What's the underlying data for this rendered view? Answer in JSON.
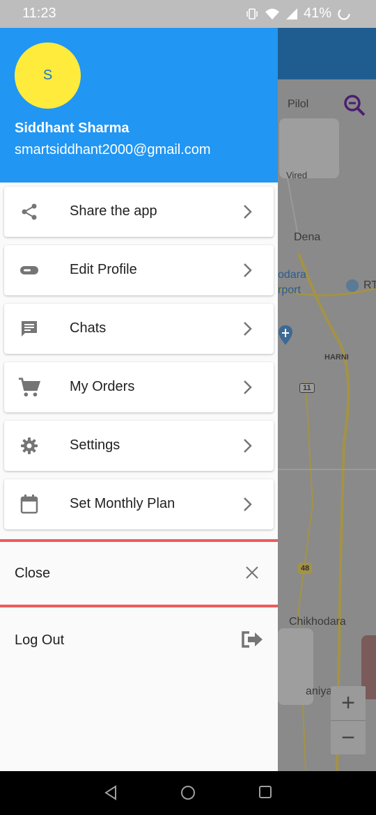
{
  "status_bar": {
    "time": "11:23",
    "battery": "41%"
  },
  "map": {
    "labels": {
      "pilol": "Pilol",
      "vired": "Vired",
      "dena": "Dena",
      "vadodara": "odara",
      "airport": "rport",
      "rt": "RT",
      "harni": "HARNI",
      "nh11": "11",
      "nh48": "48",
      "chikhodara": "Chikhodara",
      "aniyad": "aniyad"
    },
    "zoom_in": "+",
    "zoom_out": "−",
    "colors": {
      "appbar": "#1f5d91",
      "road": "#a49345"
    }
  },
  "drawer": {
    "header": {
      "avatar_initial": "S",
      "name": "Siddhant Sharma",
      "email": "smartsiddhant2000@gmail.com",
      "color": "#2196f3"
    },
    "menu": [
      {
        "label": "Share the app",
        "icon": "share-icon"
      },
      {
        "label": "Edit Profile",
        "icon": "toggle-icon"
      },
      {
        "label": "Chats",
        "icon": "chat-icon"
      },
      {
        "label": "My Orders",
        "icon": "cart-icon"
      },
      {
        "label": "Settings",
        "icon": "gear-icon"
      },
      {
        "label": "Set Monthly Plan",
        "icon": "calendar-icon"
      }
    ],
    "close_label": "Close",
    "logout_label": "Log Out",
    "divider_color": "#f05a5a"
  }
}
